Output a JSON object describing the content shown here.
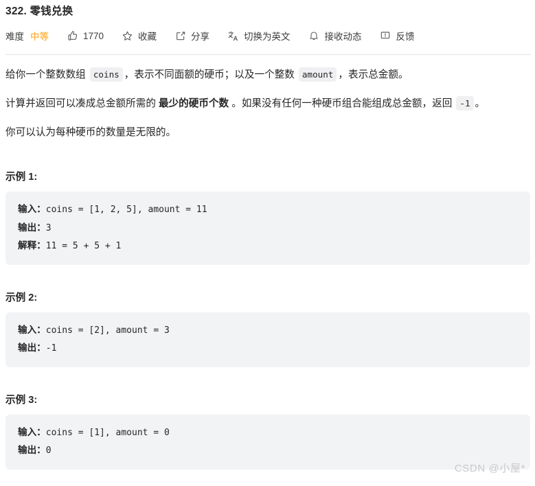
{
  "header": {
    "title": "322. 零钱兑换",
    "toolbar": {
      "difficulty_label": "难度",
      "difficulty_value": "中等",
      "difficulty_color": "#ffa116",
      "likes_count": "1770",
      "favorite_label": "收藏",
      "share_label": "分享",
      "translate_label": "切换为英文",
      "subscribe_label": "接收动态",
      "feedback_label": "反馈",
      "icons": {
        "like": "thumbs-up-icon",
        "favorite": "star-icon",
        "share": "share-box-icon",
        "translate": "translate-icon",
        "subscribe": "bell-icon",
        "feedback": "comment-icon"
      }
    }
  },
  "description": {
    "p1_a": "给你一个整数数组",
    "p1_code1": "coins",
    "p1_b": "，表示不同面额的硬币；以及一个整数",
    "p1_code2": "amount",
    "p1_c": "，表示总金额。",
    "p2_a": "计算并返回可以凑成总金额所需的",
    "p2_bold": "最少的硬币个数",
    "p2_b": "。如果没有任何一种硬币组合能组成总金额，返回",
    "p2_code": "-1",
    "p2_c": "。",
    "p3": "你可以认为每种硬币的数量是无限的。"
  },
  "examples": [
    {
      "heading": "示例 1:",
      "lines": [
        {
          "key": "输入：",
          "code": "coins = [1, 2, 5], amount = 11"
        },
        {
          "key": "输出：",
          "code": "3"
        },
        {
          "key": "解释：",
          "code": "11 = 5 + 5 + 1"
        }
      ]
    },
    {
      "heading": "示例 2:",
      "lines": [
        {
          "key": "输入：",
          "code": "coins = [2], amount = 3"
        },
        {
          "key": "输出：",
          "code": "-1"
        }
      ]
    },
    {
      "heading": "示例 3:",
      "lines": [
        {
          "key": "输入：",
          "code": "coins = [1], amount = 0"
        },
        {
          "key": "输出：",
          "code": "0"
        }
      ]
    }
  ],
  "watermark": "CSDN @小屋*"
}
